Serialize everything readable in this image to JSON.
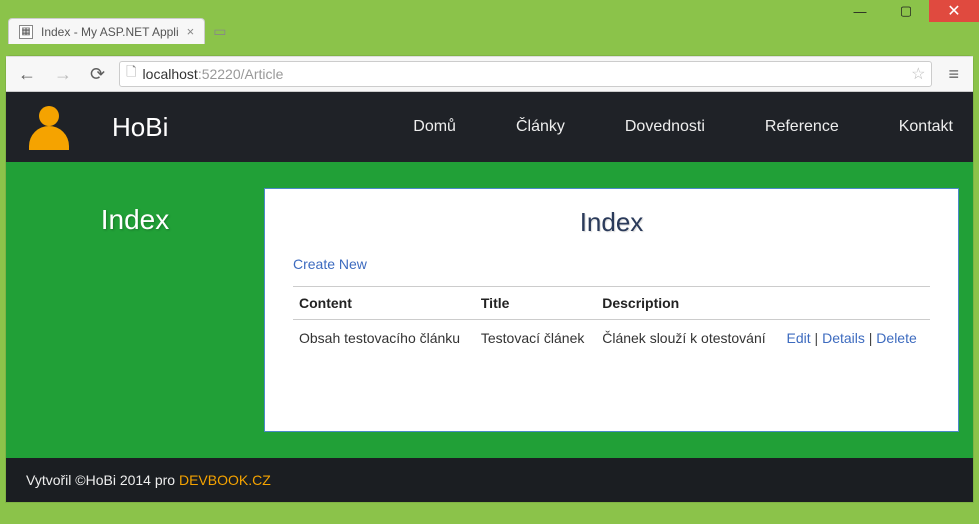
{
  "window": {
    "tab_title": "Index - My ASP.NET Appli"
  },
  "browser": {
    "url_host": "localhost",
    "url_port": ":52220",
    "url_path": "/Article"
  },
  "nav": {
    "brand": "HoBi",
    "items": [
      "Domů",
      "Články",
      "Dovednosti",
      "Reference",
      "Kontakt"
    ]
  },
  "page": {
    "side_title": "Index",
    "card_title": "Index",
    "create_link": "Create New",
    "columns": {
      "content": "Content",
      "title": "Title",
      "description": "Description"
    },
    "rows": [
      {
        "content": "Obsah testovacího článku",
        "title": "Testovací článek",
        "description": "Článek slouží k otestování",
        "actions": {
          "edit": "Edit",
          "details": "Details",
          "delete": "Delete"
        }
      }
    ]
  },
  "footer": {
    "text_prefix": "Vytvořil ©HoBi 2014 pro ",
    "devbook": "DEVBOOK.CZ"
  }
}
